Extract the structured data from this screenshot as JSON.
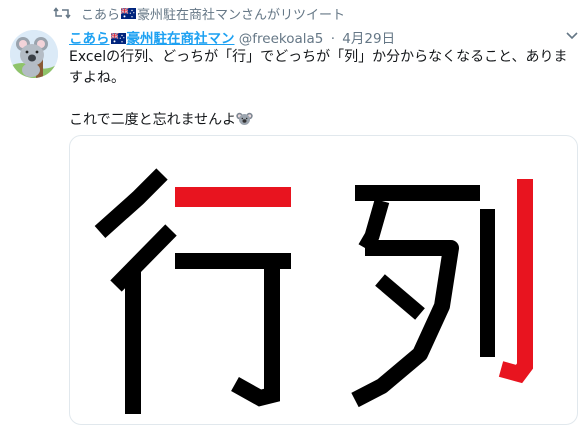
{
  "retweet": {
    "name": "こあら",
    "suffix": "豪州駐在商社マンさんがリツイート"
  },
  "author": {
    "display_name_prefix": "こあら",
    "display_name_suffix": "豪州駐在商社マン",
    "handle": "@freekoala5",
    "separator": "·",
    "date": "4月29日"
  },
  "tweet": {
    "line1": "Excelの行列、どっちが「行」でどっちが「列」か分からなくなること、ありますよね。",
    "line2": "これで二度と忘れませんよ"
  },
  "image": {
    "char_row": "行",
    "char_col": "列"
  },
  "icons": {
    "retweet": "retweet-icon",
    "flag": "australia-flag-icon",
    "koala": "koala-emoji-icon",
    "menu": "chevron-down-icon"
  },
  "colors": {
    "link": "#1da1f2",
    "muted": "#657786",
    "highlight": "#e8141f",
    "ink": "#000000",
    "flag_blue": "#00247d"
  }
}
